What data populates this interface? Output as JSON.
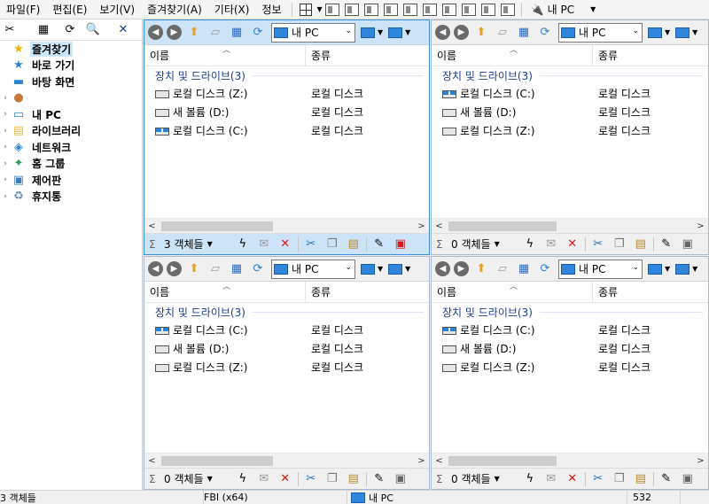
{
  "menu": [
    "파일(F)",
    "편집(E)",
    "보기(V)",
    "즐겨찾기(A)",
    "기타(X)",
    "정보"
  ],
  "toolbar": {
    "location_label": "내 PC",
    "inet_label": "inet"
  },
  "tree": {
    "items": [
      {
        "label": "즐겨찾기",
        "icon": "star-icon"
      },
      {
        "label": "바로 가기",
        "icon": "pin-icon"
      },
      {
        "label": "바탕 화면",
        "icon": "desktop-icon"
      },
      {
        "label": "",
        "icon": "user-icon"
      },
      {
        "label": "내 PC",
        "icon": "computer-icon"
      },
      {
        "label": "라이브러리",
        "icon": "library-icon"
      },
      {
        "label": "네트워크",
        "icon": "network-icon"
      },
      {
        "label": "홈 그룹",
        "icon": "homegroup-icon"
      },
      {
        "label": "제어판",
        "icon": "control-panel-icon"
      },
      {
        "label": "휴지통",
        "icon": "recycle-bin-icon"
      }
    ]
  },
  "panes": [
    {
      "address": "내 PC",
      "col_name": "이름",
      "col_type": "종류",
      "group": "장치 및 드라이브(3)",
      "rows": [
        {
          "name": "로컬 디스크 (Z:)",
          "type": "로컬 디스크"
        },
        {
          "name": "새 볼륨 (D:)",
          "type": "로컬 디스크"
        },
        {
          "name": "로컬 디스크 (C:)",
          "type": "로컬 디스크"
        }
      ],
      "status": "3 객체들"
    },
    {
      "address": "내 PC",
      "col_name": "이름",
      "col_type": "종류",
      "group": "장치 및 드라이브(3)",
      "rows": [
        {
          "name": "로컬 디스크 (C:)",
          "type": "로컬 디스크"
        },
        {
          "name": "새 볼륨 (D:)",
          "type": "로컬 디스크"
        },
        {
          "name": "로컬 디스크 (Z:)",
          "type": "로컬 디스크"
        }
      ],
      "status": "0 객체들"
    },
    {
      "address": "내 PC",
      "col_name": "이름",
      "col_type": "종류",
      "group": "장치 및 드라이브(3)",
      "rows": [
        {
          "name": "로컬 디스크 (C:)",
          "type": "로컬 디스크"
        },
        {
          "name": "새 볼륨 (D:)",
          "type": "로컬 디스크"
        },
        {
          "name": "로컬 디스크 (Z:)",
          "type": "로컬 디스크"
        }
      ],
      "status": "0 객체들"
    },
    {
      "address": "내 PC",
      "col_name": "이름",
      "col_type": "종류",
      "group": "장치 및 드라이브(3)",
      "rows": [
        {
          "name": "로컬 디스크 (C:)",
          "type": "로컬 디스크"
        },
        {
          "name": "새 볼륨 (D:)",
          "type": "로컬 디스크"
        },
        {
          "name": "로컬 디스크 (Z:)",
          "type": "로컬 디스크"
        }
      ],
      "status": "0 객체들"
    }
  ],
  "statusbar": {
    "objects": "3 객체들",
    "app": "FBI (x64)",
    "location": "내 PC",
    "value": "532"
  }
}
